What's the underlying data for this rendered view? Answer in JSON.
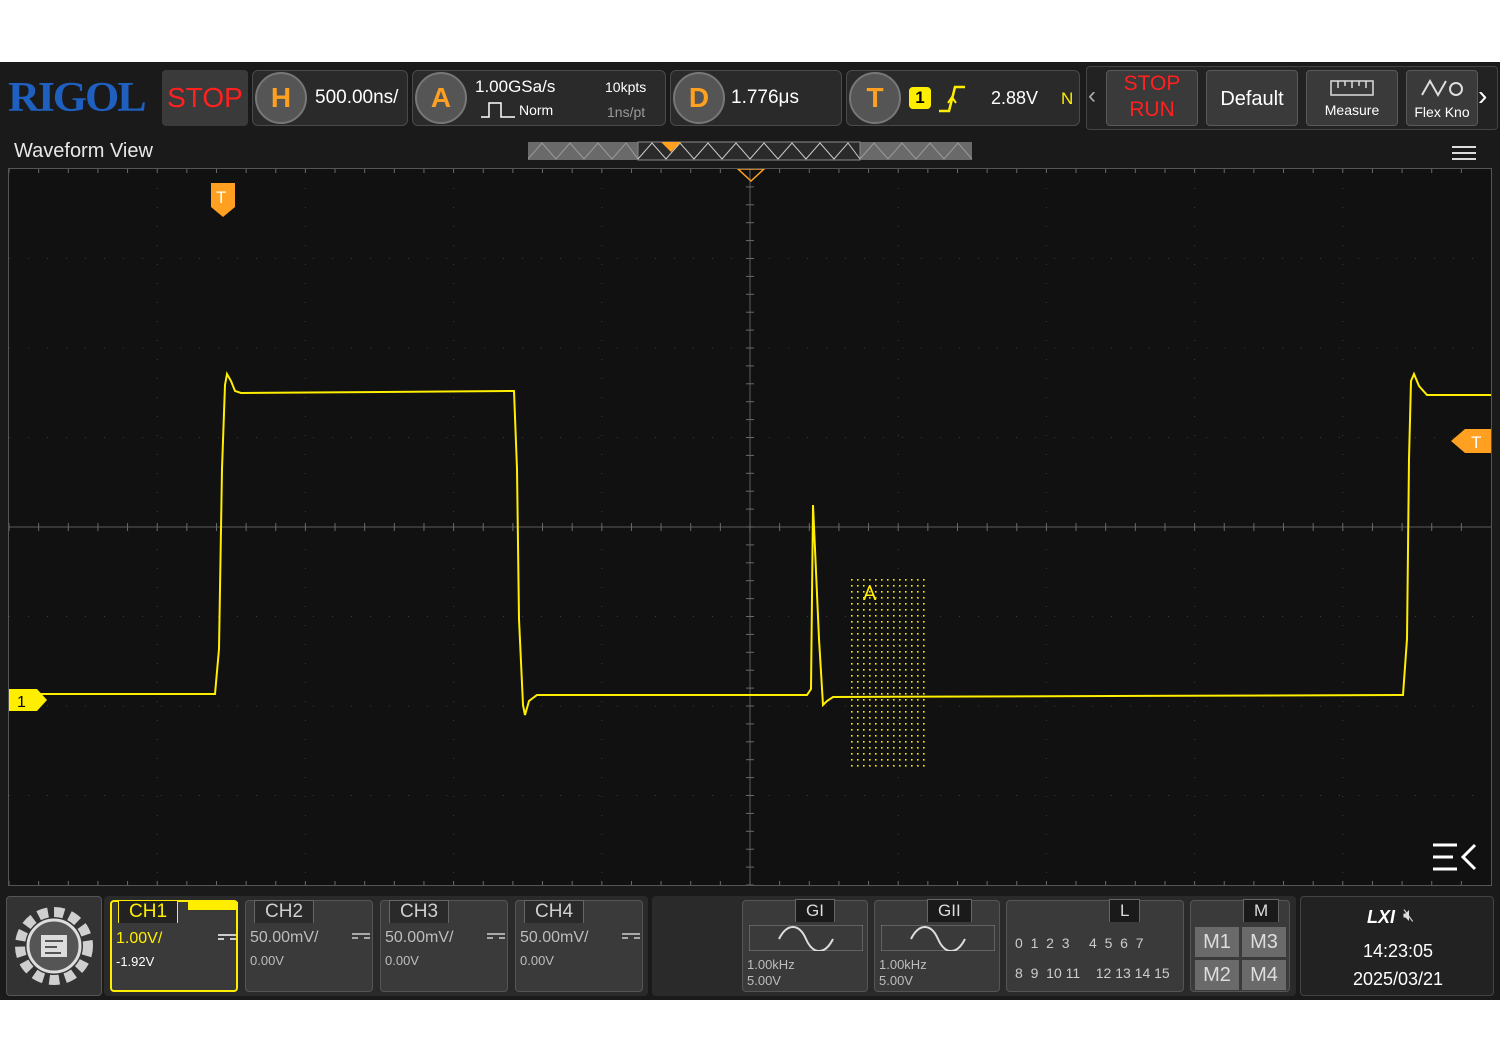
{
  "brand": "RIGOL",
  "run_state": "STOP",
  "horizontal": {
    "key": "H",
    "timebase": "500.00ns/"
  },
  "acquire": {
    "key": "A",
    "sample_rate": "1.00GSa/s",
    "memory": "10kpts",
    "mode": "Norm",
    "resolution": "1ns/pt"
  },
  "delay": {
    "key": "D",
    "value": "1.776μs"
  },
  "trigger": {
    "key": "T",
    "source": "1",
    "level": "2.88V",
    "sweep": "N"
  },
  "buttons": {
    "stop": "STOP",
    "run": "RUN",
    "default": "Default",
    "measure": "Measure",
    "flex": "Flex Kno"
  },
  "waveform_view": {
    "title": "Waveform View",
    "trigger_marker": "T",
    "channel_marker": "1",
    "area_label": "A"
  },
  "channels": [
    {
      "name": "CH1",
      "scale": "1.00V/",
      "offset": "-1.92V",
      "active": true,
      "color": "#ffee00"
    },
    {
      "name": "CH2",
      "scale": "50.00mV/",
      "offset": "0.00V",
      "active": false
    },
    {
      "name": "CH3",
      "scale": "50.00mV/",
      "offset": "0.00V",
      "active": false
    },
    {
      "name": "CH4",
      "scale": "50.00mV/",
      "offset": "0.00V",
      "active": false
    }
  ],
  "generators": [
    {
      "name": "GI",
      "freq": "1.00kHz",
      "amp": "5.00V"
    },
    {
      "name": "GII",
      "freq": "1.00kHz",
      "amp": "5.00V"
    }
  ],
  "logic": {
    "name": "L",
    "row1": [
      "0",
      "1",
      "2",
      "3",
      "4",
      "5",
      "6",
      "7"
    ],
    "row2": [
      "8",
      "9",
      "10",
      "11",
      "12",
      "13",
      "14",
      "15"
    ]
  },
  "math": {
    "name": "M",
    "items": [
      "M1",
      "M3",
      "M2",
      "M4"
    ]
  },
  "status": {
    "lxi": "LXI",
    "time": "14:23:05",
    "date": "2025/03/21"
  },
  "colors": {
    "trace": "#ffee00",
    "accent": "#ffa020",
    "stop": "#ff2020"
  }
}
